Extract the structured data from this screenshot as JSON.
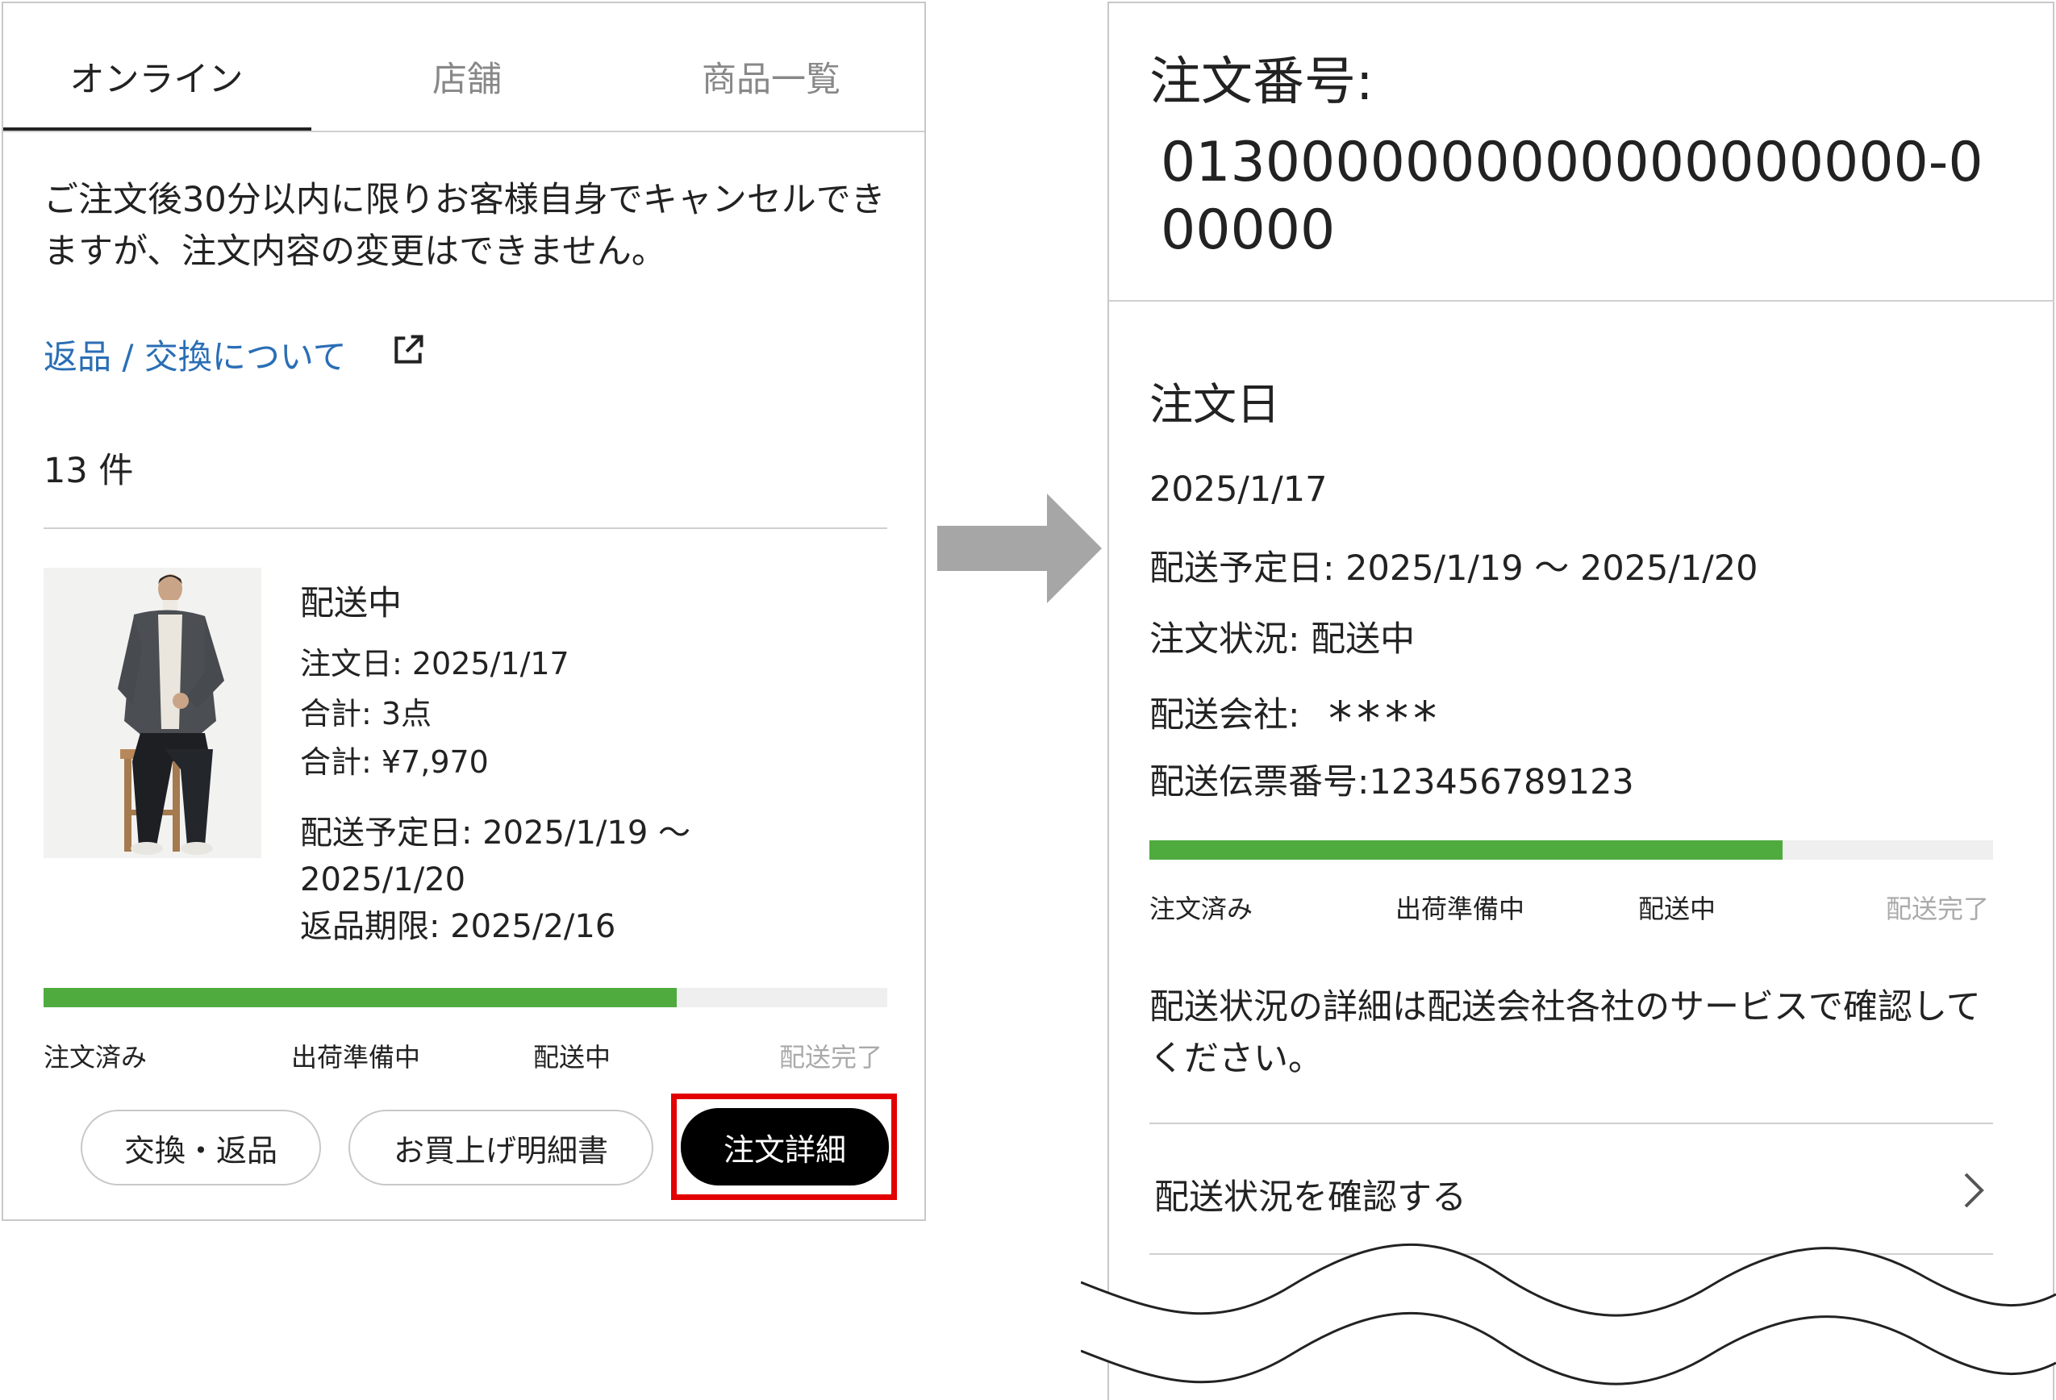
{
  "left": {
    "tabs": [
      {
        "label": "オンライン",
        "active": true
      },
      {
        "label": "店舗",
        "active": false
      },
      {
        "label": "商品一覧",
        "active": false
      }
    ],
    "notice": "ご注文後30分以内に限りお客様自身でキャンセルできますが、注文内容の変更はできません。",
    "return_link": "返品 / 交換について",
    "count": "13 件",
    "order": {
      "status": "配送中",
      "order_date": "注文日: 2025/1/17",
      "total_items": "合計: 3点",
      "total_price": "合計: ¥7,970",
      "delivery_line1": "配送予定日: 2025/1/19 〜",
      "delivery_line2": "2025/1/20",
      "return_deadline": "返品期限: 2025/2/16"
    },
    "progress": {
      "fraction": 0.75,
      "steps": [
        "注文済み",
        "出荷準備中",
        "配送中",
        "配送完了"
      ]
    },
    "buttons": {
      "exchange": "交換・返品",
      "receipt": "お買上げ明細書",
      "detail": "注文詳細"
    }
  },
  "right": {
    "order_number_label": "注文番号:",
    "order_number": "0130000000000000000000-000000",
    "order_date_heading": "注文日",
    "order_date": "2025/1/17",
    "delivery_date": "配送予定日: 2025/1/19 〜 2025/1/20",
    "order_status": "注文状況: 配送中",
    "carrier_label": "配送会社:",
    "carrier_value": "****",
    "tracking": "配送伝票番号:123456789123",
    "progress": {
      "fraction": 0.75,
      "steps": [
        "注文済み",
        "出荷準備中",
        "配送中",
        "配送完了"
      ]
    },
    "note": "配送状況の詳細は配送会社各社のサービスで確認してください。",
    "check_link": "配送状況を確認する"
  },
  "colors": {
    "progress": "#4fab3e",
    "link": "#2a6eb5",
    "highlight": "#e20000",
    "arrow": "#a6a6a6"
  }
}
